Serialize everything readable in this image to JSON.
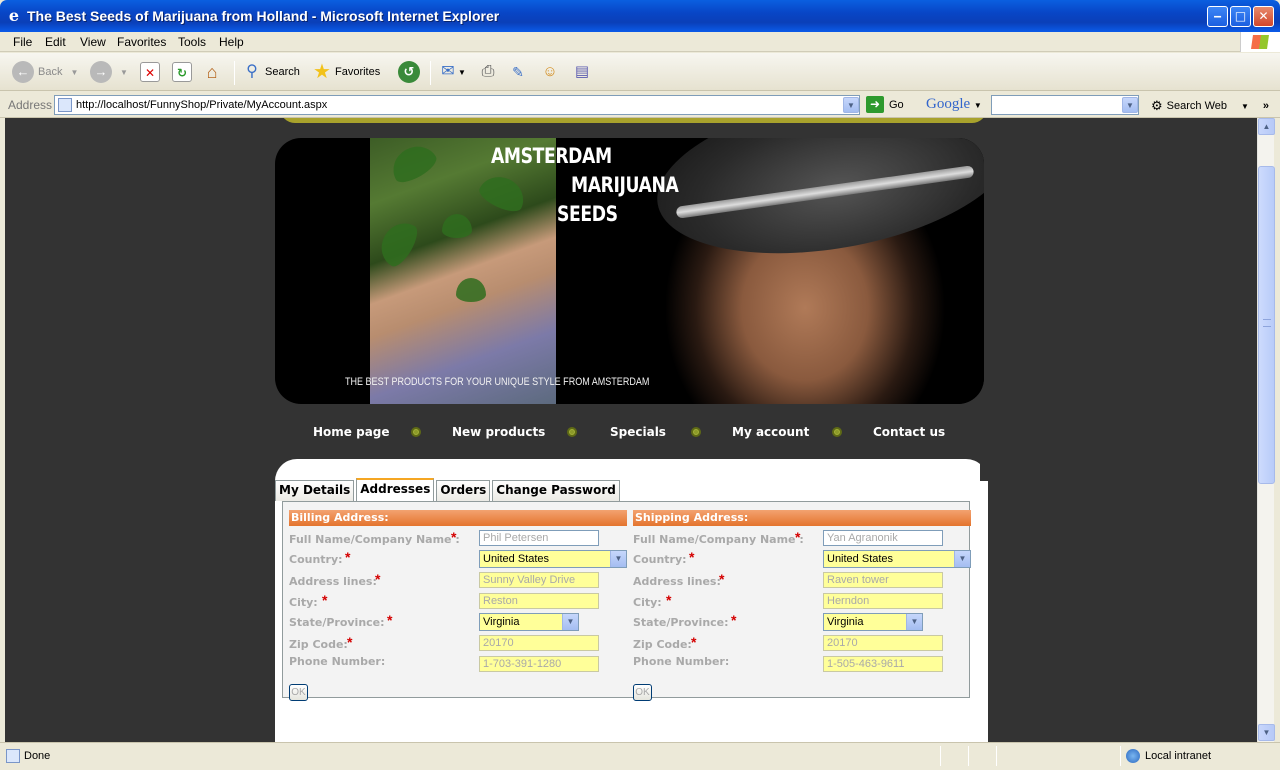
{
  "window": {
    "title": "The Best Seeds of Marijuana from Holland - Microsoft Internet Explorer",
    "minimize": "‒",
    "maximize": "□",
    "close": "✕"
  },
  "menu": [
    "File",
    "Edit",
    "View",
    "Favorites",
    "Tools",
    "Help"
  ],
  "toolbar": {
    "back": "Back",
    "search": "Search",
    "favorites": "Favorites"
  },
  "address": {
    "label": "Address",
    "url": "http://localhost/FunnyShop/Private/MyAccount.aspx",
    "go": "Go",
    "google": "Google",
    "search_web": "Search Web"
  },
  "banner": {
    "line1": "AMSTERDAM",
    "line2": "MARIJUANA",
    "line3": "SEEDS",
    "tagline": "THE BEST PRODUCTS FOR YOUR UNIQUE STYLE FROM AMSTERDAM"
  },
  "nav": [
    "Home page",
    "New products",
    "Specials",
    "My account",
    "Contact us"
  ],
  "tabs": [
    "My Details",
    "Addresses",
    "Orders",
    "Change Password"
  ],
  "active_tab": "Addresses",
  "labels": {
    "full_name": "Full Name/Company Name :",
    "country": "Country:",
    "address_lines": "Address lines:",
    "city": "City:",
    "state": "State/Province:",
    "zip": "Zip Code:",
    "phone": "Phone Number:",
    "required_mark": "*",
    "ok": "OK"
  },
  "billing": {
    "heading": "Billing Address:",
    "full_name": "Phil Petersen",
    "country": "United States",
    "address_lines": "Sunny Valley Drive",
    "city": "Reston",
    "state": "Virginia",
    "zip": "20170",
    "phone": "1-703-391-1280"
  },
  "shipping": {
    "heading": "Shipping Address:",
    "full_name": "Yan Agranonik",
    "country": "United States",
    "address_lines": "Raven tower",
    "city": "Herndon",
    "state": "Virginia",
    "zip": "20170",
    "phone": "1-505-463-9611"
  },
  "status": {
    "text": "Done",
    "zone": "Local intranet"
  },
  "colors": {
    "page_bg": "#333333",
    "accent_olive": "#a8a22c",
    "section_header": "#e4742e",
    "input_bg": "#ffff99",
    "required": "#d40000"
  }
}
